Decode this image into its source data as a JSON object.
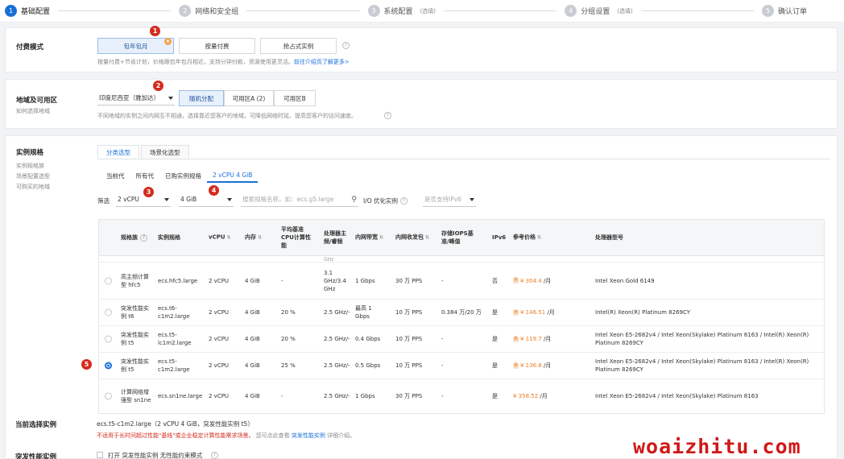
{
  "steps": [
    {
      "num": "1",
      "label": "基础配置",
      "hint": ""
    },
    {
      "num": "2",
      "label": "网络和安全组",
      "hint": ""
    },
    {
      "num": "3",
      "label": "系统配置",
      "hint": "(选填)"
    },
    {
      "num": "4",
      "label": "分组设置",
      "hint": "(选填)"
    },
    {
      "num": "5",
      "label": "确认订单",
      "hint": ""
    }
  ],
  "billing": {
    "title": "付费模式",
    "options": [
      "包年包月",
      "按量付费",
      "抢占式实例"
    ],
    "selected_mark": "★",
    "note": "按量付费+节省计划，价格跟包年包月相近，支持分钟付款，资源使用更灵活。",
    "note_link": "前往介绍页了解更多>"
  },
  "region": {
    "title": "地域及可用区",
    "sub": "如何选择地域",
    "value": "印度尼西亚（雅加达）",
    "zones": [
      "随机分配",
      "可用区A (2)",
      "可用区B"
    ],
    "note": "不同地域的实例之间内网互不相通，选择靠近您客户的地域，可降低网络时延、提高您客户的访问速度。"
  },
  "spec": {
    "title": "实例规格",
    "sub": [
      "实例规格族",
      "场景配置选型",
      "可购买的地域"
    ],
    "tabs": [
      "分类选型",
      "场景化选型"
    ],
    "subtabs": [
      "当前代",
      "所有代",
      "已购实例规格",
      "2 vCPU 4 GiB"
    ],
    "filter_label": "筛选",
    "vcpu": "2 vCPU",
    "memory": "4 GiB",
    "search_placeholder": "搜索规格名称，如：ecs.g5.large",
    "io_label": "I/O 优化实例",
    "ipv6_placeholder": "是否支持IPv6"
  },
  "table": {
    "headers": [
      "规格族",
      "实例规格",
      "vCPU",
      "内存",
      "平均基准CPU计算性能",
      "处理器主频/睿频",
      "内网带宽",
      "内网收发包",
      "存储IOPS基准/峰值",
      "IPv6",
      "参考价格",
      "处理器型号"
    ],
    "partial": "GHz",
    "rows": [
      {
        "family": "高主频计算型 hfc5",
        "spec": "ecs.hfc5.large",
        "vcpu": "2 vCPU",
        "mem": "4 GiB",
        "cpu_perf": "-",
        "freq": "3.1 GHz/3.4 GHz",
        "bw": "1 Gbps",
        "pps": "30 万 PPS",
        "iops": "-",
        "ipv6": "否",
        "price": "¥ 304.4",
        "unit": "/月",
        "proc": "Intel Xeon Gold 6149"
      },
      {
        "family": "突发性能实例 t6",
        "spec": "ecs.t6-c1m2.large",
        "vcpu": "2 vCPU",
        "mem": "4 GiB",
        "cpu_perf": "20 %",
        "freq": "2.5 GHz/-",
        "bw": "最高 1 Gbps",
        "pps": "10 万 PPS",
        "iops": "0.384 万/20 万",
        "ipv6": "是",
        "price": "¥ 146.51",
        "unit": "/月",
        "proc": "Intel(R) Xeon(R) Platinum 8269CY"
      },
      {
        "family": "突发性能实例 t5",
        "spec": "ecs.t5-lc1m2.large",
        "vcpu": "2 vCPU",
        "mem": "4 GiB",
        "cpu_perf": "20 %",
        "freq": "2.5 GHz/-",
        "bw": "0.4 Gbps",
        "pps": "10 万 PPS",
        "iops": "-",
        "ipv6": "是",
        "price": "¥ 119.7",
        "unit": "/月",
        "proc": "Intel Xeon E5-2682v4 / Intel Xeon(Skylake) Platinum 8163 / Intel(R) Xeon(R) Platinum 8269CY"
      },
      {
        "family": "突发性能实例 t5",
        "spec": "ecs.t5-c1m2.large",
        "vcpu": "2 vCPU",
        "mem": "4 GiB",
        "cpu_perf": "25 %",
        "freq": "2.5 GHz/-",
        "bw": "0.5 Gbps",
        "pps": "10 万 PPS",
        "iops": "-",
        "ipv6": "是",
        "price": "¥ 136.8",
        "unit": "/月",
        "proc": "Intel Xeon E5-2682v4 / Intel Xeon(Skylake) Platinum 8163 / Intel(R) Xeon(R) Platinum 8269CY"
      },
      {
        "family": "计算网络增强型 sn1ne",
        "spec": "ecs.sn1ne.large",
        "vcpu": "2 vCPU",
        "mem": "4 GiB",
        "cpu_perf": "-",
        "freq": "2.5 GHz/-",
        "bw": "1 Gbps",
        "pps": "30 万 PPS",
        "iops": "-",
        "ipv6": "是",
        "price": "¥ 358.52",
        "unit": "/月",
        "proc": "Intel Xeon E5-2682v4 / Intel Xeon(Skylake) Platinum 8163"
      }
    ],
    "selected_row": 3
  },
  "current": {
    "title": "当前选择实例",
    "value": "ecs.t5-c1m2.large（2 vCPU 4 GiB，突发性能实例 t5）",
    "warning": "不适用于长时间超过性能\"基线\"或企业稳定计算性能需求场景。",
    "warning_tail": "您可点此查看",
    "warning_link": "突发性能实例",
    "warning_end": "详细介绍。"
  },
  "burst": {
    "title": "突发性能实例",
    "option": "打开 突发性能实例 无性能约束模式"
  },
  "annotations": [
    "1",
    "2",
    "3",
    "4",
    "5"
  ],
  "watermark": "woaizhitu.com",
  "colors": {
    "accent": "#1a6fd8",
    "badge": "#d42b1e",
    "price": "#f07c20",
    "watermark": "#d01818"
  }
}
